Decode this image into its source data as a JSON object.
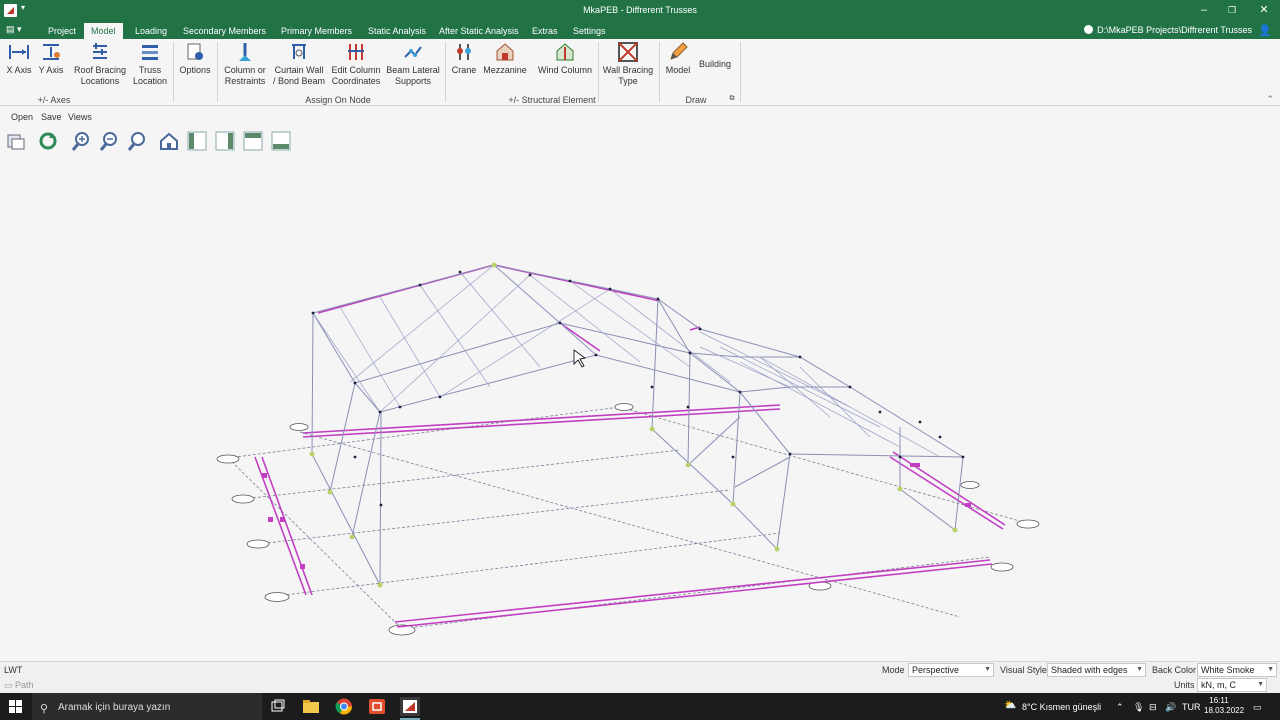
{
  "window": {
    "title": "MkaPEB - Diffrerent Trusses",
    "quick_access": "▾",
    "project_path": "D:\\MkaPEB Projects\\Diffrerent Trusses"
  },
  "tabs": [
    "Project",
    "Model",
    "Loading",
    "Secondary Members",
    "Primary Members",
    "Static Analysis",
    "After Static Analysis",
    "Extras",
    "Settings"
  ],
  "active_tab": "Model",
  "ribbon": {
    "x_axis": "X Axis",
    "y_axis": "Y Axis",
    "roof_bracing_1": "Roof Bracing",
    "roof_bracing_2": "Locations",
    "truss_1": "Truss",
    "truss_2": "Location",
    "options": "Options",
    "column_1": "Column or",
    "column_2": "Restraints",
    "curtain_1": "Curtain Wall",
    "curtain_2": "/ Bond Beam",
    "edit_col_1": "Edit Column",
    "edit_col_2": "Coordinates",
    "beam_lat_1": "Beam Lateral",
    "beam_lat_2": "Supports",
    "crane": "Crane",
    "mezzanine": "Mezzanine",
    "wind_column": "Wind Column",
    "wall_bracing_1": "Wall Bracing",
    "wall_bracing_2": "Type",
    "model": "Model",
    "building": "Building",
    "group_axes": "+/-  Axes",
    "group_assign": "Assign On Node",
    "group_structural": "+/-  Structural Element",
    "group_draw": "Draw",
    "collapse": "⌃"
  },
  "views_menu": [
    "Open",
    "Save",
    "Views"
  ],
  "status": {
    "left": "LWT",
    "mode_label": "Mode",
    "mode_value": "Perspective",
    "visual_label": "Visual Style",
    "visual_value": "Shaded with edges",
    "back_label": "Back Color",
    "back_value": "White Smoke",
    "units_label": "Units",
    "units_value": "kN, m, C",
    "path_label": "Path"
  },
  "taskbar": {
    "search_placeholder": "Aramak için buraya yazın",
    "weather": "8°C  Kısmen güneşli",
    "lang": "TUR",
    "time": "16:11",
    "date": "18.03.2022"
  },
  "colors": {
    "accent": "#217346",
    "frame_line": "#8a8fb5",
    "bracing": "#c23fc2",
    "support": "#b9d36a",
    "node": "#202040"
  }
}
